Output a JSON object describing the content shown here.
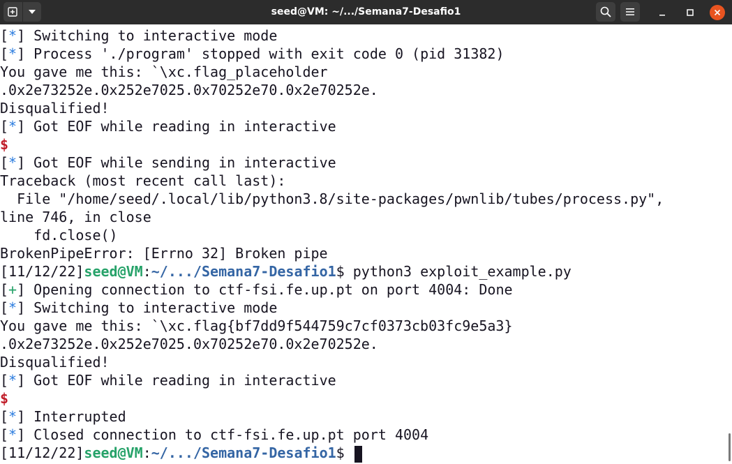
{
  "window": {
    "title": "seed@VM: ~/.../Semana7-Desafio1",
    "icons": {
      "new_tab": "new-tab-icon",
      "dropdown": "chevron-down-icon",
      "search": "search-icon",
      "menu": "hamburger-menu-icon",
      "minimize": "minimize-icon",
      "maximize": "maximize-icon",
      "close": "close-icon"
    },
    "colors": {
      "titlebar": "#2c2c2c",
      "close": "#e95420",
      "prompt_user": "#26a269",
      "prompt_path": "#3465a4",
      "status_star": "#2a7bde",
      "status_plus": "#26a269",
      "dollar": "#c01c28"
    }
  },
  "terminal": {
    "lines": [
      {
        "kind": "status",
        "mark": "*",
        "text": " Switching to interactive mode"
      },
      {
        "kind": "status",
        "mark": "*",
        "text": " Process './program' stopped with exit code 0 (pid 31382)"
      },
      {
        "kind": "plain",
        "text": "You gave me this: `\\xc.flag_placeholder"
      },
      {
        "kind": "plain",
        "text": ".0x2e73252e.0x252e7025.0x70252e70.0x2e70252e."
      },
      {
        "kind": "plain",
        "text": "Disqualified!"
      },
      {
        "kind": "status",
        "mark": "*",
        "text": " Got EOF while reading in interactive"
      },
      {
        "kind": "dollar",
        "text": "$"
      },
      {
        "kind": "status",
        "mark": "*",
        "text": " Got EOF while sending in interactive"
      },
      {
        "kind": "plain",
        "text": "Traceback (most recent call last):"
      },
      {
        "kind": "plain",
        "text": "  File \"/home/seed/.local/lib/python3.8/site-packages/pwnlib/tubes/process.py\","
      },
      {
        "kind": "plain",
        "text": "line 746, in close"
      },
      {
        "kind": "plain",
        "text": "    fd.close()"
      },
      {
        "kind": "plain",
        "text": "BrokenPipeError: [Errno 32] Broken pipe"
      },
      {
        "kind": "prompt",
        "date": "[11/12/22]",
        "user": "seed@VM",
        "sep": ":",
        "path": "~/.../Semana7-Desafio1",
        "sym": "$ ",
        "cmd": "python3 exploit_example.py"
      },
      {
        "kind": "status_plus",
        "mark": "+",
        "text": " Opening connection to ctf-fsi.fe.up.pt on port 4004: Done"
      },
      {
        "kind": "status",
        "mark": "*",
        "text": " Switching to interactive mode"
      },
      {
        "kind": "plain",
        "text": "You gave me this: `\\xc.flag{bf7dd9f544759c7cf0373cb03fc9e5a3}"
      },
      {
        "kind": "plain",
        "text": ".0x2e73252e.0x252e7025.0x70252e70.0x2e70252e."
      },
      {
        "kind": "plain",
        "text": "Disqualified!"
      },
      {
        "kind": "status",
        "mark": "*",
        "text": " Got EOF while reading in interactive"
      },
      {
        "kind": "dollar",
        "text": "$"
      },
      {
        "kind": "status",
        "mark": "*",
        "text": " Interrupted"
      },
      {
        "kind": "status",
        "mark": "*",
        "text": " Closed connection to ctf-fsi.fe.up.pt port 4004"
      },
      {
        "kind": "prompt_cursor",
        "date": "[11/12/22]",
        "user": "seed@VM",
        "sep": ":",
        "path": "~/.../Semana7-Desafio1",
        "sym": "$ ",
        "cmd": ""
      }
    ]
  }
}
